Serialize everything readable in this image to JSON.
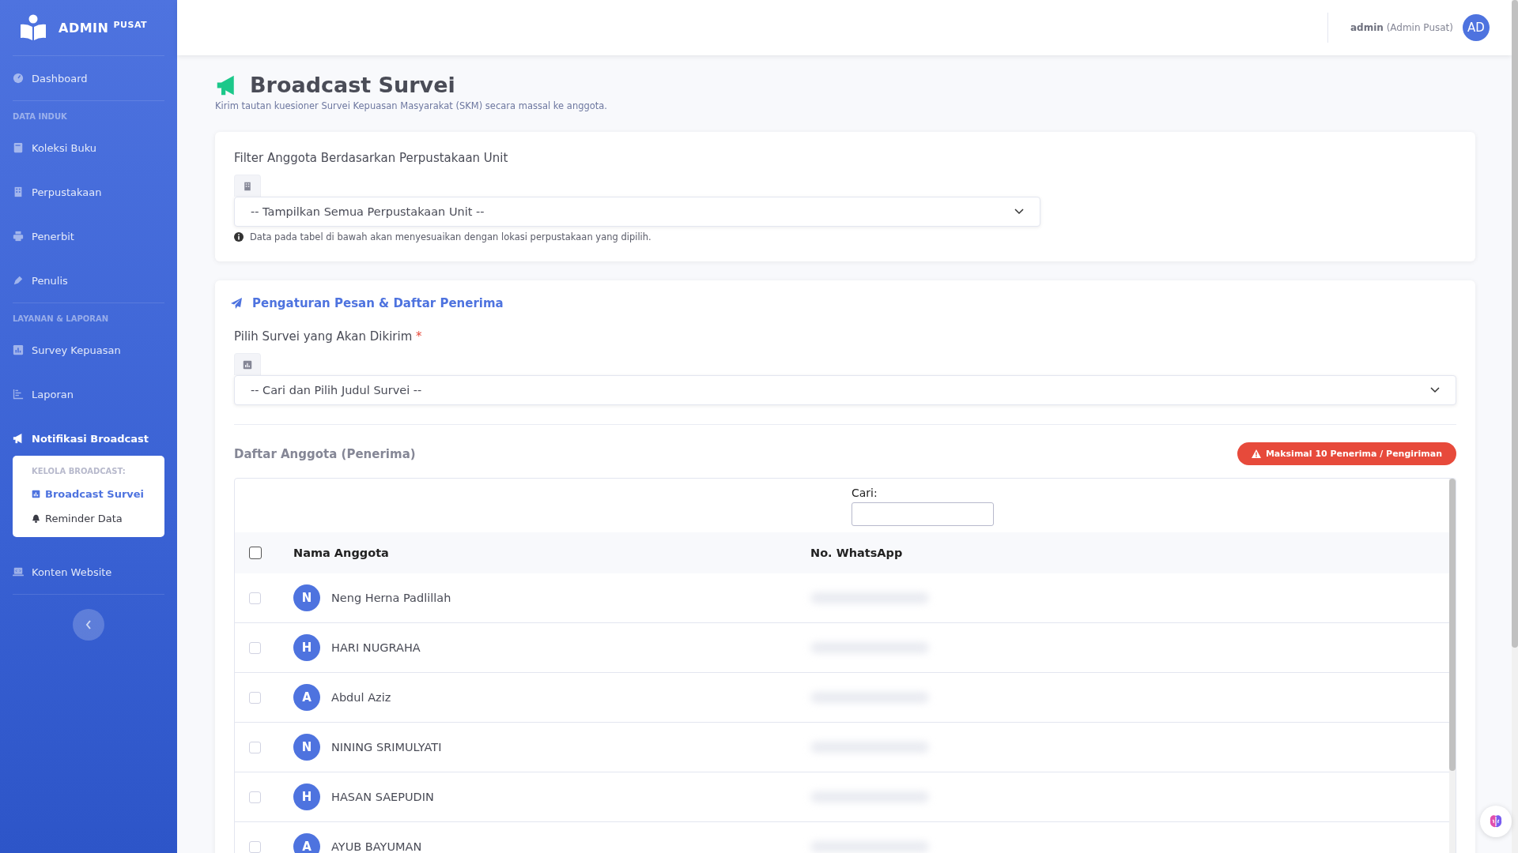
{
  "sidebar": {
    "brand": {
      "title": "ADMIN",
      "sup": "PUSAT"
    },
    "items": [
      {
        "kind": "link",
        "label": "Dashboard",
        "selected": false
      },
      {
        "kind": "heading",
        "label": "DATA INDUK"
      },
      {
        "kind": "link",
        "label": "Koleksi Buku",
        "selected": false
      },
      {
        "kind": "link",
        "label": "Perpustakaan",
        "selected": false
      },
      {
        "kind": "link",
        "label": "Penerbit",
        "selected": false
      },
      {
        "kind": "link",
        "label": "Penulis",
        "selected": false
      },
      {
        "kind": "heading",
        "label": "LAYANAN & LAPORAN"
      },
      {
        "kind": "link",
        "label": "Survey Kepuasan",
        "selected": false
      },
      {
        "kind": "link",
        "label": "Laporan",
        "selected": false
      },
      {
        "kind": "link",
        "label": "Notifikasi Broadcast",
        "selected": true,
        "expanded": true,
        "submenu": {
          "heading": "KELOLA BROADCAST:",
          "items": [
            {
              "label": "Broadcast Survei",
              "selected": true
            },
            {
              "label": "Reminder Data",
              "selected": false
            }
          ]
        }
      },
      {
        "kind": "link",
        "label": "Konten Website",
        "selected": false
      }
    ]
  },
  "topbar": {
    "user": "admin",
    "role": "(Admin Pusat)",
    "avatar": "AD"
  },
  "page": {
    "title": "Broadcast Survei",
    "subtitle": "Kirim tautan kuesioner Survei Kepuasan Masyarakat (SKM) secara massal ke anggota."
  },
  "filter": {
    "label": "Filter Anggota Berdasarkan Perpustakaan Unit",
    "select": "-- Tampilkan Semua Perpustakaan Unit --",
    "help": "Data pada tabel di bawah akan menyesuaikan dengan lokasi perpustakaan yang dipilih."
  },
  "settings": {
    "title": "Pengaturan Pesan & Daftar Penerima",
    "survey_label": "Pilih Survei yang Akan Dikirim",
    "required_mark": "*",
    "survey_select": "-- Cari dan Pilih Judul Survei --",
    "members_title": "Daftar Anggota (Penerima)",
    "limit_badge": "Maksimal 10 Penerima / Pengiriman",
    "search_label": "Cari:",
    "table": {
      "all_checked": false,
      "columns": [
        "Nama Anggota",
        "No. WhatsApp"
      ],
      "rows": [
        {
          "initial": "N",
          "name": "Neng Herna Padlillah",
          "checked": false
        },
        {
          "initial": "H",
          "name": "HARI NUGRAHA",
          "checked": false
        },
        {
          "initial": "A",
          "name": "Abdul Aziz",
          "checked": false
        },
        {
          "initial": "N",
          "name": "NINING SRIMULYATI",
          "checked": false
        },
        {
          "initial": "H",
          "name": "HASAN SAEPUDIN",
          "checked": false
        },
        {
          "initial": "A",
          "name": "AYUB BAYUMAN",
          "checked": false
        }
      ]
    }
  }
}
